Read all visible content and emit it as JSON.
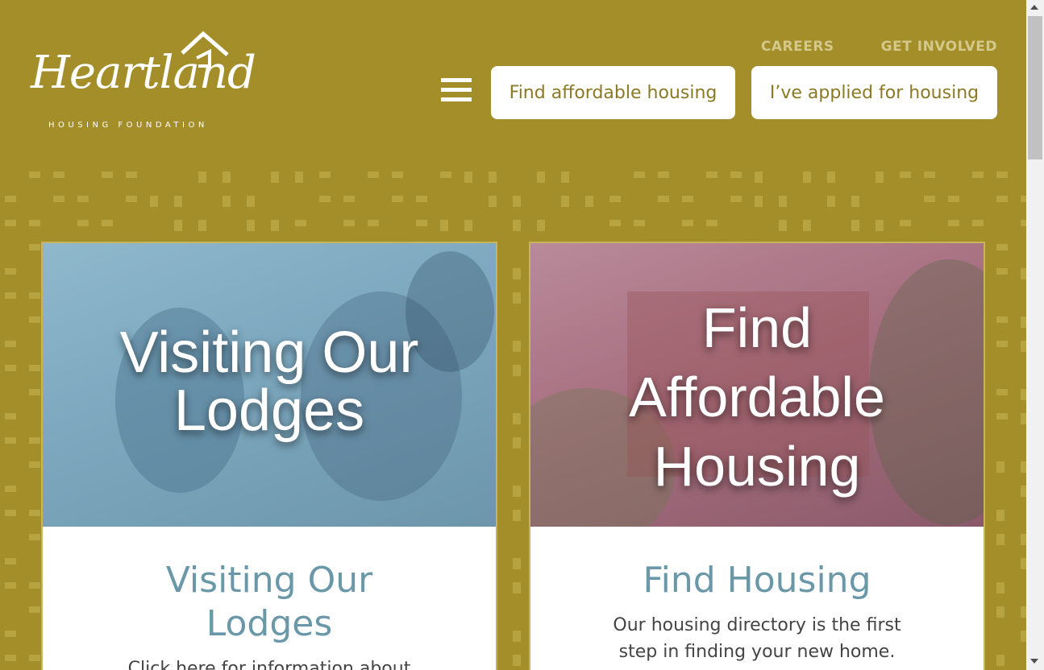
{
  "header": {
    "logo_script": "Heartland",
    "logo_sub": "HOUSING FOUNDATION",
    "top_links": [
      "CAREERS",
      "GET INVOLVED"
    ],
    "cta_buttons": [
      "Find affordable housing",
      "I’ve applied for housing"
    ]
  },
  "cards": [
    {
      "image_text": "Visiting Our Lodges",
      "title": "Visiting Our Lodges",
      "description": "Click here for information about"
    },
    {
      "image_text": "Find Affordable Housing",
      "title": "Find Housing",
      "description": "Our housing directory is the first step in finding your new home."
    }
  ],
  "colors": {
    "background": "#a38e2a",
    "accent_title": "#6a98a8",
    "cta_text": "#8a7a24",
    "top_link": "#d4c88a"
  }
}
